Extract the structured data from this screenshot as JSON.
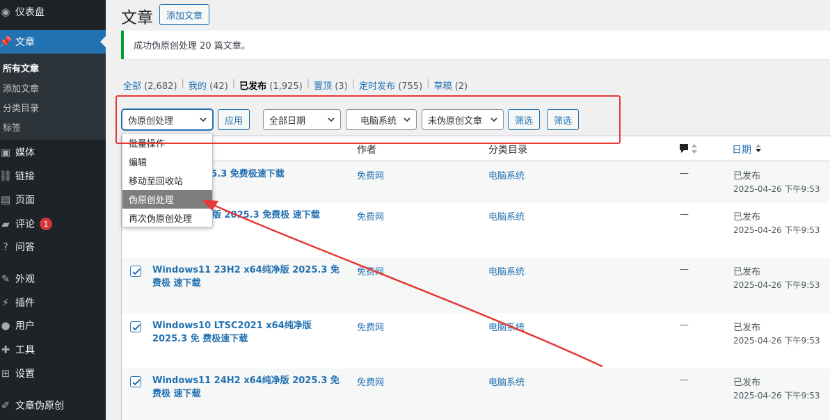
{
  "sidebar": {
    "items": [
      {
        "label": "仪表盘",
        "icon": "dashboard-icon"
      },
      {
        "label": "文章",
        "icon": "pin-icon",
        "active": true
      },
      {
        "label": "媒体",
        "icon": "media-icon"
      },
      {
        "label": "链接",
        "icon": "link-icon"
      },
      {
        "label": "页面",
        "icon": "page-icon"
      },
      {
        "label": "评论",
        "icon": "comment-icon",
        "badge": "1"
      },
      {
        "label": "问答",
        "icon": "question-icon"
      },
      {
        "label": "外观",
        "icon": "appearance-icon"
      },
      {
        "label": "插件",
        "icon": "plugin-icon"
      },
      {
        "label": "用户",
        "icon": "user-icon"
      },
      {
        "label": "工具",
        "icon": "tools-icon"
      },
      {
        "label": "设置",
        "icon": "settings-icon"
      },
      {
        "label": "文章伪原创",
        "icon": "rewrite-icon"
      }
    ],
    "submenu": [
      "所有文章",
      "添加文章",
      "分类目录",
      "标签"
    ]
  },
  "header": {
    "title": "文章",
    "add_button": "添加文章"
  },
  "notice": "成功伪原创处理 20 篇文章。",
  "filters": [
    {
      "label": "全部",
      "count": "(2,682)"
    },
    {
      "label": "我的",
      "count": "(42)"
    },
    {
      "label": "已发布",
      "count": "(1,925)",
      "current": true
    },
    {
      "label": "置顶",
      "count": "(3)"
    },
    {
      "label": "定时发布",
      "count": "(755)"
    },
    {
      "label": "草稿",
      "count": "(2)"
    }
  ],
  "controls": {
    "bulk_action": "伪原创处理",
    "apply": "应用",
    "date_filter": "全部日期",
    "category_filter": "电脑系统",
    "rewrite_filter": "未伪原创文章",
    "filter_button_1": "筛选",
    "filter_button_2": "筛选"
  },
  "bulk_menu": {
    "options": [
      "批量操作",
      "编辑",
      "移动至回收站",
      "伪原创处理",
      "再次伪原创处理"
    ],
    "highlighted": "伪原创处理"
  },
  "table": {
    "columns": {
      "author": "作者",
      "category": "分类目录",
      "date": "日期"
    },
    "rows": [
      {
        "title": "4 纯净版 2025.3 免费极速下载",
        "author": "免费网",
        "category": "电脑系统",
        "comments": "—",
        "status": "已发布",
        "date": "2025-04-26 下午9:53",
        "checked": true
      },
      {
        "title": "2H2 x64纯净版 2025.3 免费极 速下载",
        "author": "免费网",
        "category": "电脑系统",
        "comments": "—",
        "status": "已发布",
        "date": "2025-04-26 下午9:53",
        "checked": true
      },
      {
        "title": "Windows11 23H2 x64纯净版 2025.3 免费极 速下载",
        "author": "免费网",
        "category": "电脑系统",
        "comments": "—",
        "status": "已发布",
        "date": "2025-04-26 下午9:53",
        "checked": true
      },
      {
        "title": "Windows10 LTSC2021 x64纯净版 2025.3 免 费极速下载",
        "author": "免费网",
        "category": "电脑系统",
        "comments": "—",
        "status": "已发布",
        "date": "2025-04-26 下午9:53",
        "checked": true
      },
      {
        "title": "Windows11 24H2 x64纯净版 2025.3 免费极 速下载",
        "author": "免费网",
        "category": "电脑系统",
        "comments": "—",
        "status": "已发布",
        "date": "2025-04-26 下午9:53",
        "checked": true
      }
    ]
  },
  "colors": {
    "accent": "#2271b1",
    "sidebar": "#1d2327",
    "annotation": "#e53935",
    "success": "#00a32a"
  }
}
